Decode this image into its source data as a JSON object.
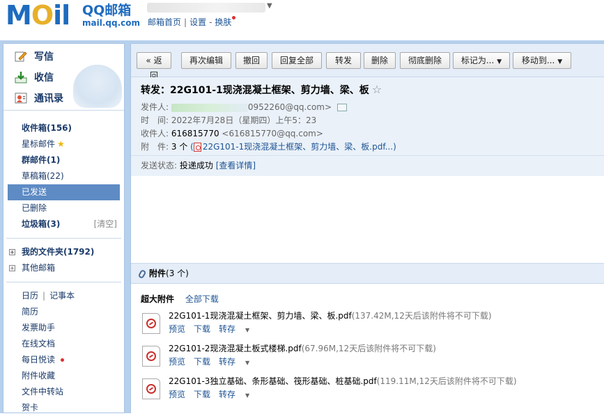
{
  "header": {
    "logo_text_m": "M",
    "logo_text_o": "O",
    "logo_text_il": "il",
    "brand_name": "QQ邮箱",
    "brand_url": "mail.qq.com",
    "toplinks": {
      "home": "邮箱首页",
      "settings": "设置",
      "skin": "换肤"
    }
  },
  "sidebar": {
    "quick": [
      {
        "label": "写信",
        "icon": "compose-icon"
      },
      {
        "label": "收信",
        "icon": "inbox-download-icon"
      },
      {
        "label": "通讯录",
        "icon": "contacts-icon"
      }
    ],
    "folders": [
      {
        "label": "收件箱(156)"
      },
      {
        "label": "星标邮件"
      },
      {
        "label": "群邮件(1)"
      },
      {
        "label": "草稿箱(22)"
      },
      {
        "label": "已发送"
      },
      {
        "label": "已删除"
      },
      {
        "label": "垃圾箱(3)",
        "action": "[清空]"
      }
    ],
    "groups": [
      {
        "label": "我的文件夹(1792)"
      },
      {
        "label": "其他邮箱"
      }
    ],
    "tools": {
      "calendar": "日历",
      "notes": "记事本",
      "resume": "简历",
      "invoice": "发票助手",
      "docs": "在线文档",
      "daily": "每日悦读",
      "attach_fav": "附件收藏",
      "transfer": "文件中转站",
      "card": "贺卡"
    }
  },
  "toolbar": {
    "back": "« 返回",
    "re_edit": "再次编辑",
    "recall": "撤回",
    "reply_all": "回复全部",
    "forward": "转发",
    "delete": "删除",
    "perm_delete": "彻底删除",
    "mark_as": "标记为...",
    "move_to": "移动到..."
  },
  "mail": {
    "subject": "转发：22G101-1现浇混凝土框架、剪力墙、梁、板",
    "star": "☆",
    "from_label": "发件人:",
    "from_addr": "0952260@qq.com>",
    "time_label": "时　间:",
    "time_value": "2022年7月28日（星期四）上午5：23",
    "to_label": "收件人:",
    "to_name": "616815770",
    "to_addr": "<616815770@qq.com>",
    "attach_label": "附　件:",
    "attach_count": "3 个",
    "attach_preview": "(",
    "attach_preview_name": "22G101-1现浇混凝土框架、剪力墙、梁、板.pdf...)",
    "status_label": "发送状态:",
    "status_value": "投递成功",
    "status_link": "[查看详情]"
  },
  "attachments": {
    "title": "附件",
    "count": "(3 个)",
    "super_label": "超大附件",
    "download_all": "全部下载",
    "items": [
      {
        "name": "22G101-1现浇混凝土框架、剪力墙、梁、板.pdf",
        "info": "(137.42M,12天后该附件将不可下载)"
      },
      {
        "name": "22G101-2现浇混凝土板式楼梯.pdf",
        "info": "(67.96M,12天后该附件将不可下载)"
      },
      {
        "name": "22G101-3独立基础、条形基础、筏形基础、桩基础.pdf",
        "info": "(119.11M,12天后该附件将不可下载)"
      }
    ],
    "actions": {
      "preview": "预览",
      "download": "下载",
      "save": "转存"
    }
  }
}
